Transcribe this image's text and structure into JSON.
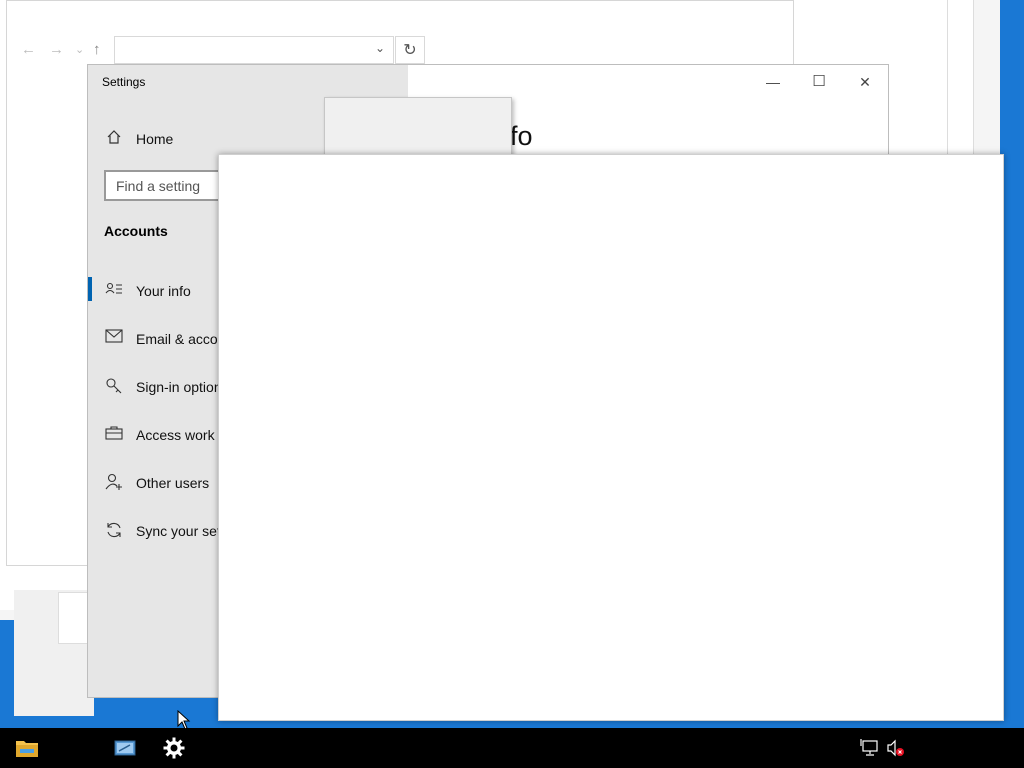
{
  "explorer": {
    "back_glyph": "←",
    "forward_glyph": "→",
    "recent_glyph": "⌄",
    "up_glyph": "↑",
    "address_value": "",
    "refresh_glyph": "↻",
    "dropdown_glyph": "⌄"
  },
  "settings": {
    "title": "Settings",
    "minimize_glyph": "—",
    "maximize_glyph": "☐",
    "close_glyph": "✕",
    "home_label": "Home",
    "search_placeholder": "Find a setting",
    "section_heading": "Accounts",
    "page_title_fragment": "fo",
    "nav_items": [
      {
        "label": "Your info",
        "icon": "person-list-icon",
        "selected": true
      },
      {
        "label": "Email & accou",
        "icon": "mail-icon",
        "selected": false
      },
      {
        "label": "Sign-in option",
        "icon": "key-icon",
        "selected": false
      },
      {
        "label": "Access work o",
        "icon": "briefcase-icon",
        "selected": false
      },
      {
        "label": "Other users",
        "icon": "person-add-icon",
        "selected": false
      },
      {
        "label": "Sync your sett",
        "icon": "sync-icon",
        "selected": false
      }
    ]
  },
  "taskbar": {
    "items": [
      "file-explorer-icon",
      "control-panel-icon",
      "settings-gear-icon"
    ],
    "tray": [
      "network-icon",
      "volume-muted-icon"
    ]
  },
  "colors": {
    "desktop": "#1a78d4",
    "accent": "#0063b1",
    "sidebar": "#e6e6e6",
    "taskbar": "#000000"
  }
}
